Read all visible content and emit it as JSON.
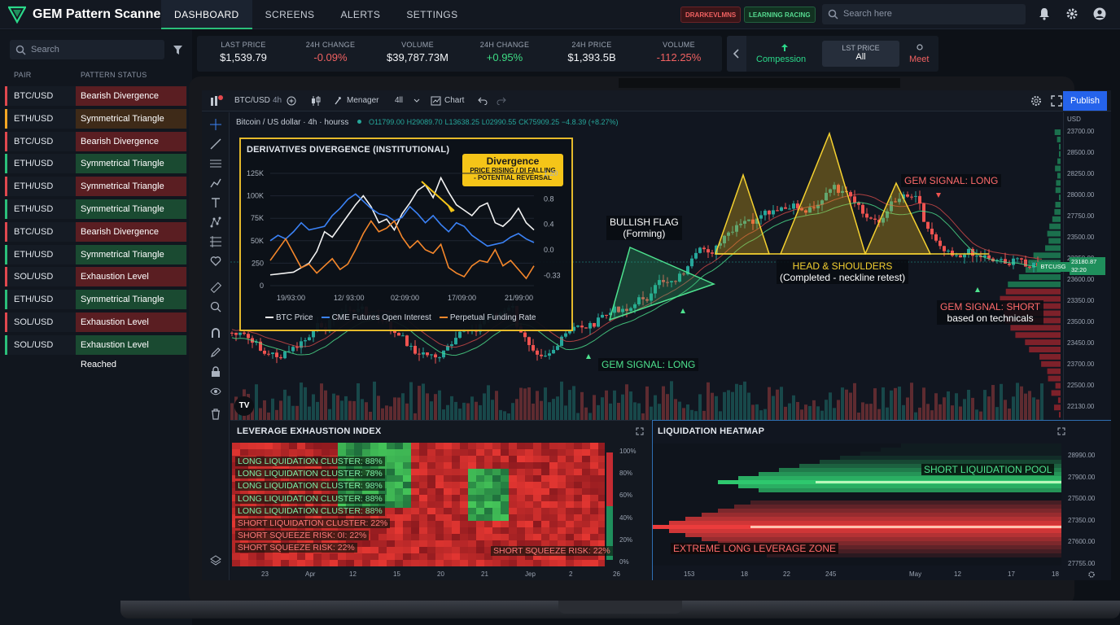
{
  "app": {
    "title": "GEM Pattern Scanner"
  },
  "nav": {
    "items": [
      "DASHBOARD",
      "SCREENS",
      "ALERTS",
      "SETTINGS"
    ],
    "active": "DASHBOARD"
  },
  "badges": {
    "red": "DRARKEVLMNS",
    "green": "LEARNING RACING"
  },
  "search": {
    "placeholder": "Search here"
  },
  "sidebar": {
    "search_placeholder": "Search",
    "col_pair": "PAIR",
    "col_status": "PATTERN STATUS",
    "rows": [
      {
        "pair": "BTC/USD",
        "status": "Bearish Divergence",
        "tone": "red"
      },
      {
        "pair": "ETH/USD",
        "status": "Symmetrical Triangle",
        "tone": "orange"
      },
      {
        "pair": "BTC/USD",
        "status": "Bearish Divergence",
        "tone": "red"
      },
      {
        "pair": "ETH/USD",
        "status": "Symmetrical Triangle",
        "tone": "green"
      },
      {
        "pair": "ETH/USD",
        "status": "Symmetrical Triangle",
        "tone": "red"
      },
      {
        "pair": "ETH/USD",
        "status": "Symmetrical Triangle",
        "tone": "green"
      },
      {
        "pair": "BTC/USD",
        "status": "Bearish Divergence",
        "tone": "red"
      },
      {
        "pair": "ETH/USD",
        "status": "Symmetrical Triangle",
        "tone": "green"
      },
      {
        "pair": "SOL/USD",
        "status": "Exhaustion Level Reached",
        "tone": "red"
      },
      {
        "pair": "ETH/USD",
        "status": "Symmetrical Triangle",
        "tone": "green"
      },
      {
        "pair": "SOL/USD",
        "status": "Exhaustion Level Reached",
        "tone": "red"
      },
      {
        "pair": "SOL/USD",
        "status": "Exhaustion Level Reached",
        "tone": "green"
      }
    ]
  },
  "stats": [
    {
      "label": "LAST PRICE",
      "value": "$1,539.79",
      "tone": "white"
    },
    {
      "label": "24H CHANGE",
      "value": "-0.09%",
      "tone": "red"
    },
    {
      "label": "VOLUME",
      "value": "$39,787.73M",
      "tone": "white"
    },
    {
      "label": "24H CHANGE",
      "value": "+0.95%",
      "tone": "green"
    },
    {
      "label": "24H PRICE",
      "value": "$1,393.5B",
      "tone": "white"
    },
    {
      "label": "VOLUME",
      "value": "-112.25%",
      "tone": "red"
    }
  ],
  "stats2": {
    "compression": "Compession",
    "last_price_label": "LST PRICE",
    "last_price_value": "All",
    "meet": "Meet"
  },
  "toolbar": {
    "symbol": "BTC/USD",
    "interval": "4h",
    "manager": "Menager",
    "interval2": "4ll",
    "chart": "Chart",
    "publish": "Publish"
  },
  "ohlc": {
    "title": "Bitcoin / US dollar · 4h · hourss",
    "o": "O11799.00",
    "h": "H29089.70",
    "l": "L13638.25",
    "l2": "L02990.55",
    "c": "CK75909.25",
    "chg": "−4.8.39 (+8.27%)"
  },
  "price_axis": {
    "unit": "USD",
    "labels": [
      "23700.00",
      "28500.00",
      "28250.00",
      "28000.00",
      "27750.00",
      "23500.00",
      "23250.00",
      "23600.00",
      "23350.00",
      "23500.00",
      "23450.00",
      "23700.00",
      "22500.00",
      "22130.00"
    ],
    "tag": "BTCUSG",
    "tag_value": "23180.87\n32:20"
  },
  "annotations": {
    "bull_flag": "BULLISH FLAG",
    "bull_flag_sub": "(Forming)",
    "hs": "HEAD & SHOULDERS",
    "hs_sub": "(Completed - neckline retest)",
    "sig_long1": "GEM SIGNAL: LONG",
    "sig_long2": "GEM SIGNAL: LONG",
    "sig_short": "GEM SIGNAL: SHORT",
    "sig_short_sub": "based on technicals"
  },
  "inset": {
    "title": "DERIVATIVES DIVERGENCE (INSTITUTIONAL)",
    "div_title": "Divergence",
    "div_sub1": "PRICE RISING / DI FALLING",
    "div_sub2": "- POTENTIAL REVERSAL",
    "legend": [
      "BTC Price",
      "CME Futures Open Interest",
      "Perpetual Funding Rate"
    ]
  },
  "chart_data": [
    {
      "type": "line",
      "title": "DERIVATIVES DIVERGENCE (INSTITUTIONAL)",
      "x_ticks": [
        "19/93:00",
        "12/ 93:00",
        "02:09:00",
        "17/09:00",
        "21/99:00"
      ],
      "y_left_ticks": [
        "125K",
        "100K",
        "75K",
        "50K",
        "250",
        "0"
      ],
      "y_right_ticks": [
        "1.20",
        "0.8",
        "0.4",
        "0.0",
        "-0.33"
      ],
      "colors": {
        "BTC Price": "#f2f2f2",
        "CME Futures Open Interest": "#3b82f6",
        "Perpetual Funding Rate": "#f5872b"
      },
      "series": [
        {
          "name": "BTC Price",
          "values": [
            12,
            13,
            14,
            15,
            20,
            25,
            38,
            60,
            54,
            66,
            78,
            90,
            100,
            88,
            70,
            74,
            62,
            80,
            92,
            106,
            112,
            98,
            120,
            104,
            90,
            84,
            78,
            88,
            92,
            70,
            66,
            74,
            86,
            70,
            62
          ]
        },
        {
          "name": "CME Futures Open Interest",
          "values": [
            50,
            56,
            52,
            60,
            70,
            62,
            64,
            66,
            78,
            86,
            96,
            102,
            94,
            86,
            80,
            78,
            72,
            76,
            88,
            80,
            70,
            78,
            68,
            60,
            70,
            66,
            56,
            50,
            44,
            46,
            48,
            54,
            58,
            52,
            48
          ]
        },
        {
          "name": "Perpetual Funding Rate",
          "values": [
            28,
            40,
            52,
            36,
            20,
            24,
            14,
            22,
            30,
            18,
            24,
            40,
            58,
            72,
            60,
            64,
            72,
            54,
            42,
            50,
            40,
            36,
            46,
            20,
            14,
            10,
            22,
            28,
            26,
            40,
            22,
            28,
            18,
            8,
            22
          ]
        }
      ]
    },
    {
      "type": "heatmap",
      "title": "LEVERAGE EXHAUSTION INDEX",
      "x_ticks": [
        "23",
        "Apr",
        "12",
        "15",
        "20",
        "21",
        "Jep",
        "2",
        "26"
      ],
      "scale": [
        "100%",
        "80%",
        "60%",
        "40%",
        "20%",
        "0%"
      ],
      "labels": [
        {
          "text": "LONG LIQUIDATION CLUSTER: 88%",
          "tone": "green"
        },
        {
          "text": "LONG LIQUIDATION CLUSTER: 78%",
          "tone": "green"
        },
        {
          "text": "LONG LIQUIDATION CLUSTER: 98%",
          "tone": "green"
        },
        {
          "text": "LONG LIQUIDATION CLUSTER: 88%",
          "tone": "green"
        },
        {
          "text": "LONG LIQUIDATION CLUSTER: 88%",
          "tone": "green"
        },
        {
          "text": "SHORT LIQUIDATION CLUSTER: 22%",
          "tone": "red"
        },
        {
          "text": "SHORT SQUEEZE RISK: 0I: 22%",
          "tone": "red"
        },
        {
          "text": "SHORT SQUEEZE RISK: 22%",
          "tone": "red"
        }
      ],
      "right_label": "SHORT SQUEEZE RISK: 22%"
    },
    {
      "type": "heatmap",
      "title": "LIQUIDATION HEATMAP",
      "x_ticks": [
        "153",
        "18",
        "22",
        "245",
        "May",
        "12",
        "17",
        "18"
      ],
      "y_ticks": [
        "28990.00",
        "27900.00",
        "27500.00",
        "27350.00",
        "27600.00",
        "27755.00"
      ],
      "labels": [
        "SHORT LIQUIDATION POOL",
        "EXTREME LONG LEVERAGE ZONE"
      ]
    }
  ]
}
